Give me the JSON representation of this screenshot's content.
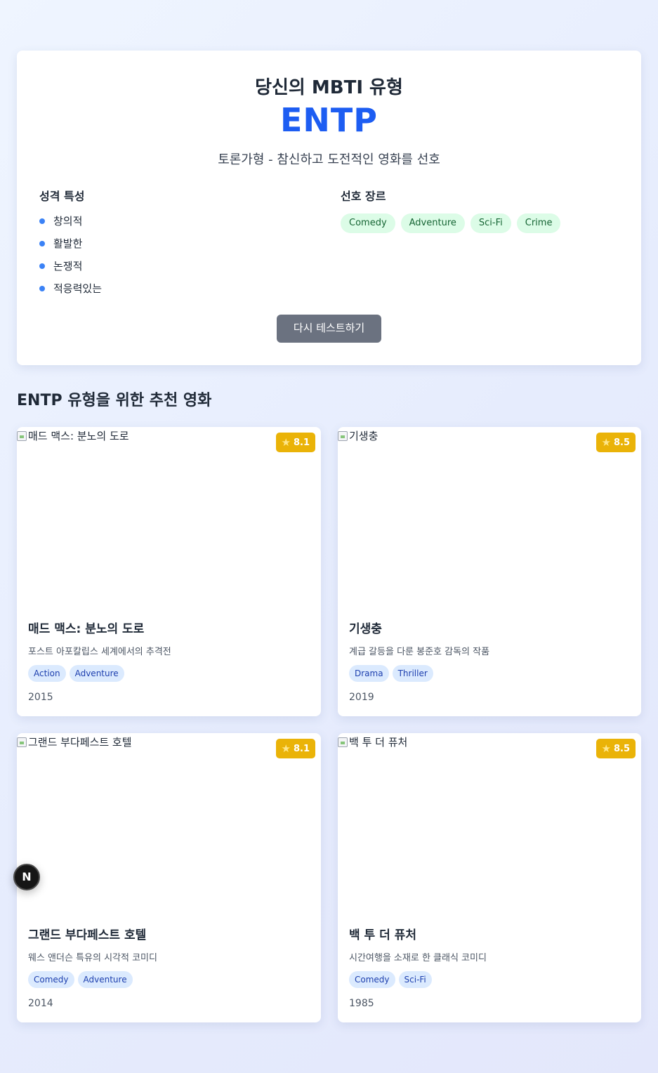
{
  "result": {
    "heading": "당신의 MBTI 유형",
    "mbti": "ENTP",
    "description": "토론가형 - 참신하고 도전적인 영화를 선호",
    "traits_title": "성격 특성",
    "traits": [
      "창의적",
      "활발한",
      "논쟁적",
      "적응력있는"
    ],
    "genres_title": "선호 장르",
    "genres": [
      "Comedy",
      "Adventure",
      "Sci-Fi",
      "Crime"
    ],
    "retry_label": "다시 테스트하기"
  },
  "recommend_title": "ENTP 유형을 위한 추천 영화",
  "movies": [
    {
      "title": "매드 맥스: 분노의 도로",
      "rating": "8.1",
      "description": "포스트 아포칼립스 세계에서의 추격전",
      "tags": [
        "Action",
        "Adventure"
      ],
      "year": "2015"
    },
    {
      "title": "기생충",
      "rating": "8.5",
      "description": "계급 갈등을 다룬 봉준호 감독의 작품",
      "tags": [
        "Drama",
        "Thriller"
      ],
      "year": "2019"
    },
    {
      "title": "그랜드 부다페스트 호텔",
      "rating": "8.1",
      "description": "웨스 앤더슨 특유의 시각적 코미디",
      "tags": [
        "Comedy",
        "Adventure"
      ],
      "year": "2014"
    },
    {
      "title": "백 투 더 퓨처",
      "rating": "8.5",
      "description": "시간여행을 소재로 한 클래식 코미디",
      "tags": [
        "Comedy",
        "Sci-Fi"
      ],
      "year": "1985"
    }
  ],
  "dev_badge": "N",
  "colors": {
    "accent": "#1d5df2",
    "rating": "#eab308",
    "genre_bg": "#dcfce7",
    "tag_bg": "#dbeafe"
  }
}
